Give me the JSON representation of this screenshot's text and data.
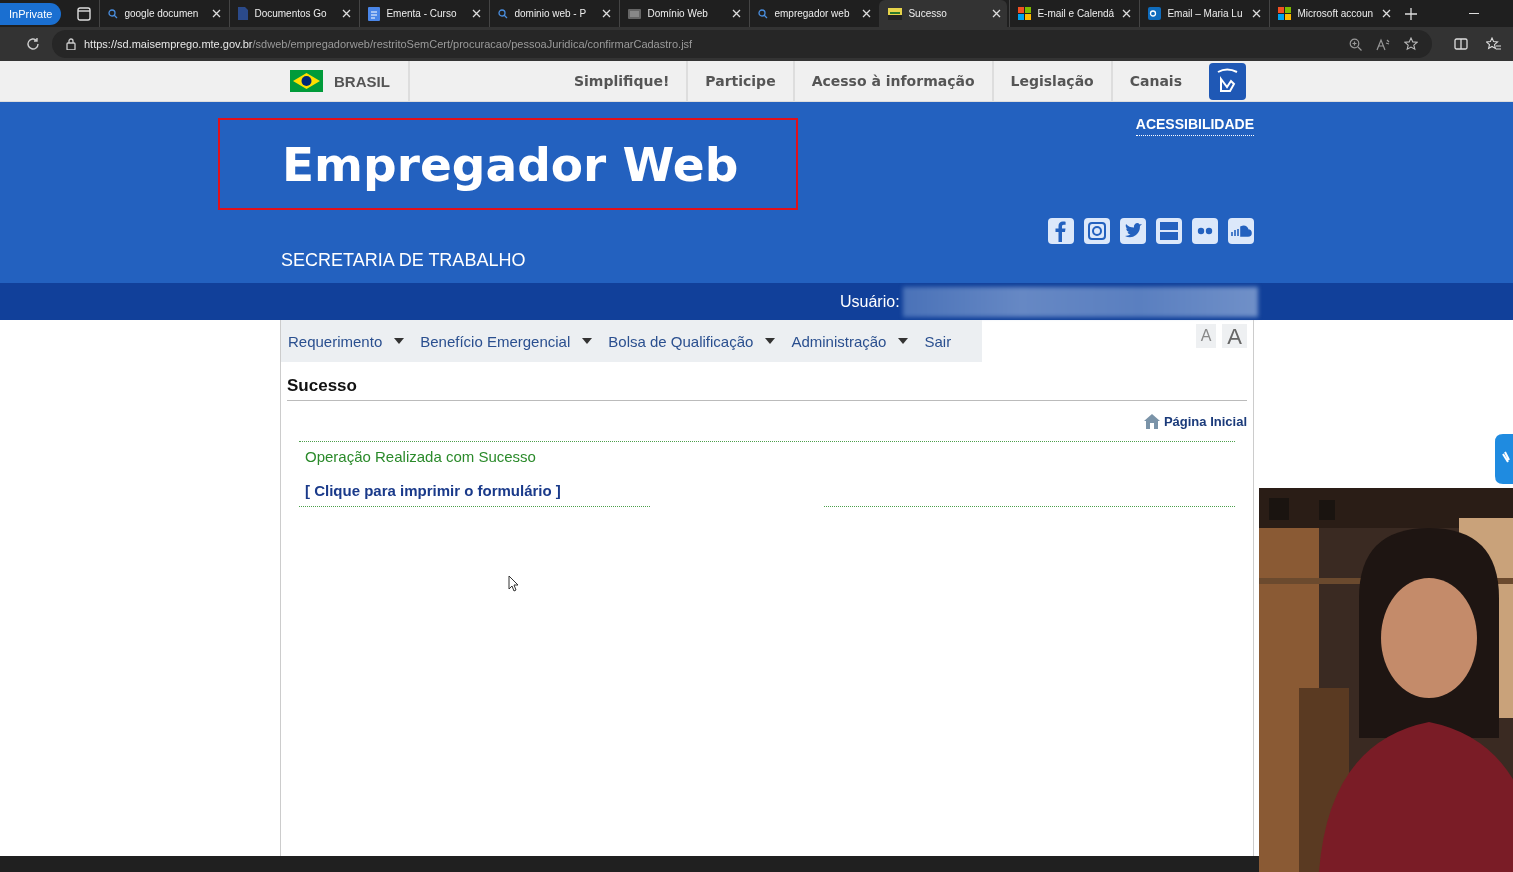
{
  "browser": {
    "private_label": "InPrivate",
    "tabs": [
      {
        "label": "google documen",
        "kind": "search",
        "selected": false
      },
      {
        "label": "Documentos Go",
        "kind": "doc",
        "selected": false
      },
      {
        "label": "Ementa - Curso",
        "kind": "docs",
        "selected": false
      },
      {
        "label": "dominio web - P",
        "kind": "search",
        "selected": false
      },
      {
        "label": "Domínio Web",
        "kind": "page",
        "selected": false
      },
      {
        "label": "empregador web",
        "kind": "search",
        "selected": false
      },
      {
        "label": "Sucesso",
        "kind": "mte",
        "selected": true
      },
      {
        "label": "E-mail e Calendá",
        "kind": "ms",
        "selected": false
      },
      {
        "label": "Email – Maria Lu",
        "kind": "outlook",
        "selected": false
      },
      {
        "label": "Microsoft accoun",
        "kind": "ms",
        "selected": false
      }
    ],
    "url_host": "https://sd.maisemprego.mte.gov.br",
    "url_path": "/sdweb/empregadorweb/restritoSemCert/procuracao/pessoaJuridica/confirmarCadastro.jsf"
  },
  "gov_bar": {
    "country": "BRASIL",
    "links": [
      "Simplifique!",
      "Participe",
      "Acesso à informação",
      "Legislação",
      "Canais"
    ]
  },
  "header": {
    "title": "Empregador Web",
    "subtitle": "SECRETARIA DE TRABALHO",
    "accessibility": "ACESSIBILIDADE",
    "user_label": "Usuário:"
  },
  "menu": [
    {
      "label": "Requerimento",
      "has_dropdown": true
    },
    {
      "label": "Benefício Emergencial",
      "has_dropdown": true
    },
    {
      "label": "Bolsa de Qualificação",
      "has_dropdown": true
    },
    {
      "label": "Administração",
      "has_dropdown": true
    },
    {
      "label": "Sair",
      "has_dropdown": false
    }
  ],
  "font_buttons": [
    "A",
    "A"
  ],
  "page": {
    "heading": "Sucesso",
    "home_link": "Página Inicial",
    "message": "Operação Realizada com Sucesso",
    "print_link": "[ Clique para imprimir o formulário ]"
  }
}
